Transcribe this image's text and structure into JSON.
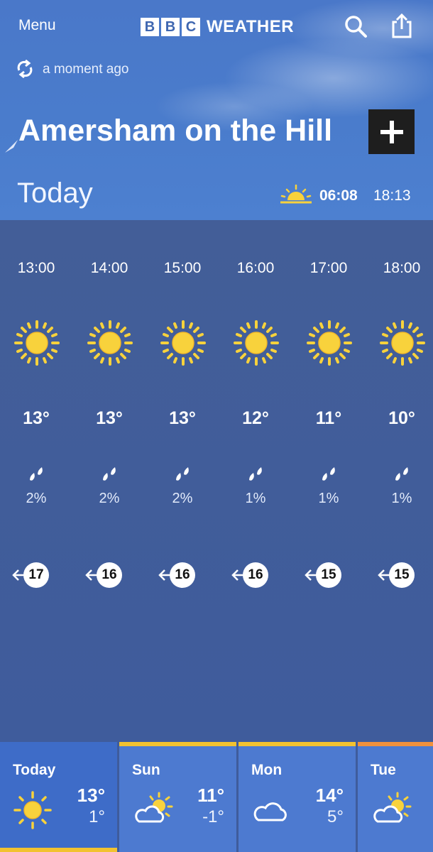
{
  "header": {
    "menu_label": "Menu",
    "logo_letters": [
      "B",
      "B",
      "C"
    ],
    "logo_word": "WEATHER"
  },
  "status": {
    "updated": "a moment ago"
  },
  "location": {
    "name": "Amersham on the Hill"
  },
  "today": {
    "title": "Today",
    "sunrise": "06:08",
    "sunset": "18:13"
  },
  "hourly": [
    {
      "time": "13:00",
      "icon": "sun-icon",
      "temp": "13°",
      "precip": "2%",
      "wind": "17"
    },
    {
      "time": "14:00",
      "icon": "sun-icon",
      "temp": "13°",
      "precip": "2%",
      "wind": "16"
    },
    {
      "time": "15:00",
      "icon": "sun-icon",
      "temp": "13°",
      "precip": "2%",
      "wind": "16"
    },
    {
      "time": "16:00",
      "icon": "sun-icon",
      "temp": "12°",
      "precip": "1%",
      "wind": "16"
    },
    {
      "time": "17:00",
      "icon": "sun-icon",
      "temp": "11°",
      "precip": "1%",
      "wind": "15"
    },
    {
      "time": "18:00",
      "icon": "sun-icon",
      "temp": "10°",
      "precip": "1%",
      "wind": "15"
    }
  ],
  "days": [
    {
      "name": "Today",
      "icon": "sun-icon",
      "high": "13°",
      "low": "1°",
      "bar_color": "#f2c230",
      "bar_position": "bottom"
    },
    {
      "name": "Sun",
      "icon": "sun-cloud-icon",
      "high": "11°",
      "low": "-1°",
      "bar_color": "#f2c230",
      "bar_position": "top"
    },
    {
      "name": "Mon",
      "icon": "cloud-icon",
      "high": "14°",
      "low": "5°",
      "bar_color": "#f2c230",
      "bar_position": "top"
    },
    {
      "name": "Tue",
      "icon": "sun-cloud-icon",
      "high": "",
      "low": "",
      "bar_color": "#f0913c",
      "bar_position": "top"
    }
  ],
  "colors": {
    "sun": "#f8d23c",
    "sun_outline": "#f2b92a",
    "sky": "#4a7ccc",
    "panel": "#3f5c9c"
  }
}
